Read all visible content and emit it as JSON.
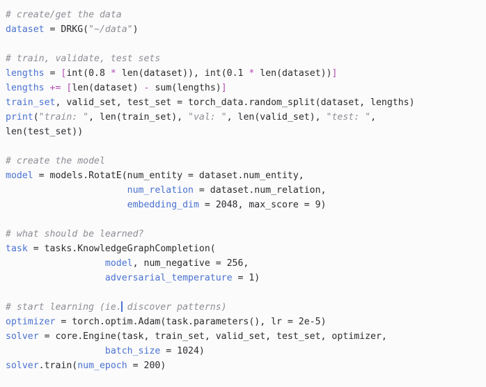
{
  "editor": {
    "background_color": "#fbfbfb",
    "default_text_color": "#2b2b30",
    "language": "python",
    "caret": {
      "visible": true,
      "color": "#4a72d0",
      "line_index": 18,
      "after_text": "# start learning (ie."
    },
    "palette": {
      "variable": "#4a72d0",
      "operator": "#b04ab0",
      "comment": "#8d8d96",
      "string": "#8d8d96",
      "plain": "#2b2b30"
    }
  },
  "code": {
    "plain_text": "# create/get the data\ndataset = DRKG(\"~/data\")\n\n# train, validate, test sets\nlengths = [int(0.8 * len(dataset)), int(0.1 * len(dataset))]\nlengths += [len(dataset) - sum(lengths)]\ntrain_set, valid_set, test_set = torch_data.random_split(dataset, lengths)\nprint(\"train: \", len(train_set), \"val: \", len(valid_set), \"test: \",\nlen(test_set))\n\n# create the model\nmodel = models.RotatE(num_entity = dataset.num_entity,\n                      num_relation = dataset.num_relation,\n                      embedding_dim = 2048, max_score = 9)\n\n# what should be learned?\ntask = tasks.KnowledgeGraphCompletion(\n                  model, num_negative = 256,\n                  adversarial_temperature = 1)\n\n# start learning (ie. discover patterns)\noptimizer = torch.optim.Adam(task.parameters(), lr = 2e-5)\nsolver = core.Engine(task, train_set, valid_set, test_set, optimizer,\n                  batch_size = 1024)\nsolver.train(num_epoch = 200)",
    "lines": [
      {
        "tokens": [
          {
            "t": "# create/get the data",
            "c": "comment"
          }
        ]
      },
      {
        "tokens": [
          {
            "t": "dataset",
            "c": "var"
          },
          {
            "t": " = DRKG(",
            "c": "plain"
          },
          {
            "t": "\"~/data\"",
            "c": "string"
          },
          {
            "t": ")",
            "c": "plain"
          }
        ]
      },
      {
        "tokens": []
      },
      {
        "tokens": [
          {
            "t": "# train, validate, test sets",
            "c": "comment"
          }
        ]
      },
      {
        "tokens": [
          {
            "t": "lengths",
            "c": "var"
          },
          {
            "t": " = ",
            "c": "plain"
          },
          {
            "t": "[",
            "c": "op"
          },
          {
            "t": "int(0.8 ",
            "c": "plain"
          },
          {
            "t": "*",
            "c": "op"
          },
          {
            "t": " len(dataset)), int(0.1 ",
            "c": "plain"
          },
          {
            "t": "*",
            "c": "op"
          },
          {
            "t": " len(dataset))",
            "c": "plain"
          },
          {
            "t": "]",
            "c": "op"
          }
        ]
      },
      {
        "tokens": [
          {
            "t": "lengths",
            "c": "var"
          },
          {
            "t": " ",
            "c": "plain"
          },
          {
            "t": "+=",
            "c": "op"
          },
          {
            "t": " ",
            "c": "plain"
          },
          {
            "t": "[",
            "c": "op"
          },
          {
            "t": "len(dataset) ",
            "c": "plain"
          },
          {
            "t": "-",
            "c": "op"
          },
          {
            "t": " sum(lengths)",
            "c": "plain"
          },
          {
            "t": "]",
            "c": "op"
          }
        ]
      },
      {
        "tokens": [
          {
            "t": "train_set",
            "c": "var"
          },
          {
            "t": ", valid_set, test_set = torch_data.random_split(dataset, lengths)",
            "c": "plain"
          }
        ]
      },
      {
        "tokens": [
          {
            "t": "print",
            "c": "var"
          },
          {
            "t": "(",
            "c": "plain"
          },
          {
            "t": "\"train: \"",
            "c": "string"
          },
          {
            "t": ", len(train_set), ",
            "c": "plain"
          },
          {
            "t": "\"val: \"",
            "c": "string"
          },
          {
            "t": ", len(valid_set), ",
            "c": "plain"
          },
          {
            "t": "\"test: \"",
            "c": "string"
          },
          {
            "t": ",",
            "c": "plain"
          }
        ]
      },
      {
        "tokens": [
          {
            "t": "len(test_set))",
            "c": "plain"
          }
        ]
      },
      {
        "tokens": []
      },
      {
        "tokens": [
          {
            "t": "# create the model",
            "c": "comment"
          }
        ]
      },
      {
        "tokens": [
          {
            "t": "model",
            "c": "var"
          },
          {
            "t": " = models.RotatE(num_entity = dataset.num_entity,",
            "c": "plain"
          }
        ]
      },
      {
        "tokens": [
          {
            "t": "                      ",
            "c": "plain"
          },
          {
            "t": "num_relation",
            "c": "var"
          },
          {
            "t": " = dataset.num_relation,",
            "c": "plain"
          }
        ]
      },
      {
        "tokens": [
          {
            "t": "                      ",
            "c": "plain"
          },
          {
            "t": "embedding_dim",
            "c": "var"
          },
          {
            "t": " = 2048, max_score = 9)",
            "c": "plain"
          }
        ]
      },
      {
        "tokens": []
      },
      {
        "tokens": [
          {
            "t": "# what should be learned?",
            "c": "comment"
          }
        ]
      },
      {
        "tokens": [
          {
            "t": "task",
            "c": "var"
          },
          {
            "t": " = tasks.KnowledgeGraphCompletion(",
            "c": "plain"
          }
        ]
      },
      {
        "tokens": [
          {
            "t": "                  ",
            "c": "plain"
          },
          {
            "t": "model",
            "c": "var"
          },
          {
            "t": ", num_negative = 256,",
            "c": "plain"
          }
        ]
      },
      {
        "tokens": [
          {
            "t": "                  ",
            "c": "plain"
          },
          {
            "t": "adversarial_temperature",
            "c": "var"
          },
          {
            "t": " = 1)",
            "c": "plain"
          }
        ]
      },
      {
        "tokens": []
      },
      {
        "tokens": [
          {
            "t": "# start learning (ie.",
            "c": "comment"
          },
          {
            "t": "CARET",
            "c": "caret"
          },
          {
            "t": " discover patterns)",
            "c": "comment"
          }
        ]
      },
      {
        "tokens": [
          {
            "t": "optimizer",
            "c": "var"
          },
          {
            "t": " = torch.optim.Adam(task.parameters(), lr = 2e-5)",
            "c": "plain"
          }
        ]
      },
      {
        "tokens": [
          {
            "t": "solver",
            "c": "var"
          },
          {
            "t": " = core.Engine(task, train_set, valid_set, test_set, optimizer,",
            "c": "plain"
          }
        ]
      },
      {
        "tokens": [
          {
            "t": "                  ",
            "c": "plain"
          },
          {
            "t": "batch_size",
            "c": "var"
          },
          {
            "t": " = 1024)",
            "c": "plain"
          }
        ]
      },
      {
        "tokens": [
          {
            "t": "solver",
            "c": "var"
          },
          {
            "t": ".train(",
            "c": "plain"
          },
          {
            "t": "num_epoch",
            "c": "var"
          },
          {
            "t": " = 200)",
            "c": "plain"
          }
        ]
      }
    ]
  }
}
